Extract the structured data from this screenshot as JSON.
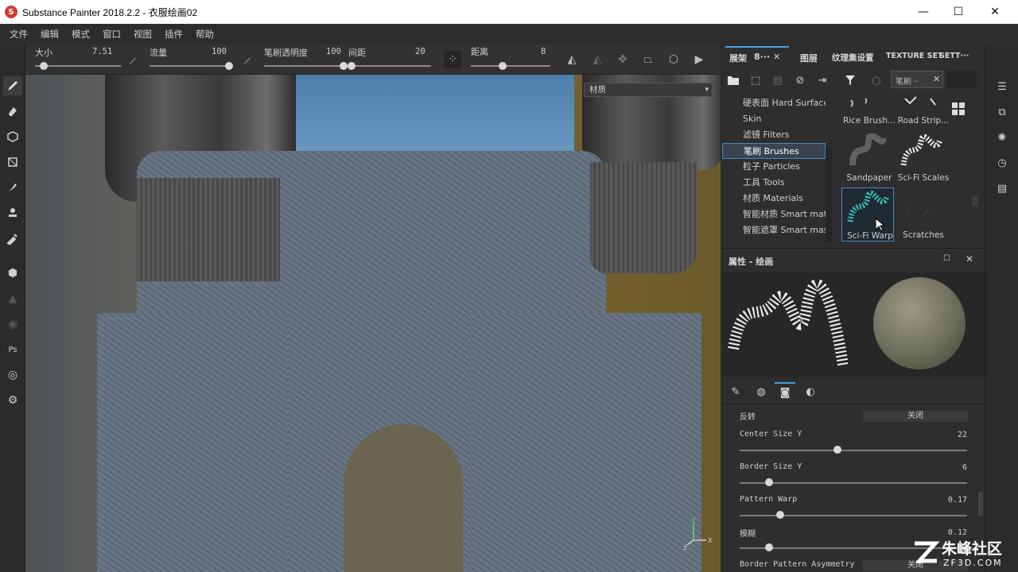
{
  "window": {
    "title": "Substance Painter 2018.2.2 - 衣服绘画02",
    "minimize": "—",
    "maximize": "☐",
    "close": "✕"
  },
  "menu": [
    "文件",
    "编辑",
    "模式",
    "窗口",
    "视图",
    "插件",
    "帮助"
  ],
  "tool_options": {
    "size": {
      "label": "大小",
      "value": "7.51",
      "level": 0.1
    },
    "flow": {
      "label": "流量",
      "value": "100",
      "level": 1.0
    },
    "opacity": {
      "label": "笔刷透明度",
      "value": "100",
      "level": 1.0
    },
    "spacing": {
      "label": "间距",
      "value": "20",
      "level": 0.0
    },
    "distance": {
      "label": "距离",
      "value": "8",
      "level": 0.4
    }
  },
  "viewport": {
    "material_select": "材质"
  },
  "shelf": {
    "tabs": [
      "展架",
      "8···",
      "图层",
      "纹理集设置",
      "TEXTURE SET",
      "SETT···"
    ],
    "search_tag": "笔刷 ··",
    "categories": [
      {
        "label": "硬表面 Hard Surface",
        "selected": false
      },
      {
        "label": "Skin",
        "selected": false
      },
      {
        "label": "滤镜 Filters",
        "selected": false
      },
      {
        "label": "笔刷 Brushes",
        "selected": true
      },
      {
        "label": "粒子 Particles",
        "selected": false
      },
      {
        "label": "工具 Tools",
        "selected": false
      },
      {
        "label": "材质 Materials",
        "selected": false
      },
      {
        "label": "智能材质 Smart mate",
        "selected": false
      },
      {
        "label": "智能遮罩 Smart mas",
        "selected": false
      }
    ],
    "thumbs": [
      {
        "label": "Rice Brush...",
        "icon": "rice-brush-thumb"
      },
      {
        "label": "Road Strip...",
        "icon": "road-strip-thumb"
      },
      {
        "label": "Sandpaper",
        "icon": "sandpaper-thumb"
      },
      {
        "label": "Sci-Fi Scales",
        "icon": "scifi-scales-thumb"
      },
      {
        "label": "Sci-Fi Warp",
        "icon": "scifi-warp-thumb"
      },
      {
        "label": "Scratches",
        "icon": "scratches-thumb"
      }
    ]
  },
  "properties": {
    "title": "属性 - 绘画",
    "params": [
      {
        "label": "反转",
        "type": "button",
        "value": "关闭"
      },
      {
        "label": "Center Size Y",
        "type": "slider",
        "value": "22",
        "level": 0.43
      },
      {
        "label": "Border Size Y",
        "type": "slider",
        "value": "6",
        "level": 0.13
      },
      {
        "label": "Pattern Warp",
        "type": "slider",
        "value": "0.17",
        "level": 0.18
      },
      {
        "label": "模糊",
        "type": "slider",
        "value": "0.12",
        "level": 0.13
      },
      {
        "label": "Border Pattern Asymmetry",
        "type": "button",
        "value": "关闭"
      }
    ]
  },
  "watermark": {
    "brand": "朱峰社区",
    "url": "ZF3D.COM"
  },
  "colors": {
    "accent": "#4aa0e0",
    "panel": "#2e2e2e",
    "selected_bg": "#3a4450"
  }
}
